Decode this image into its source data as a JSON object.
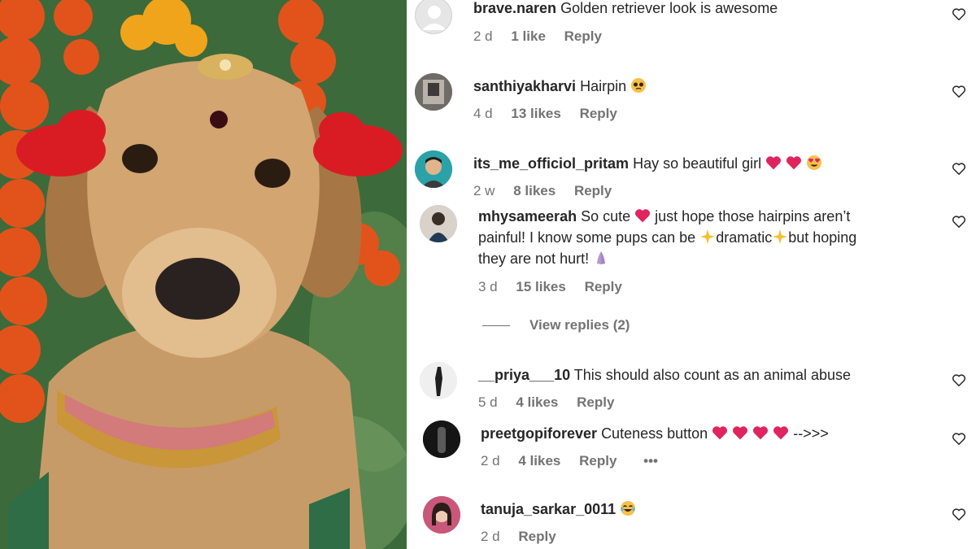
{
  "comments": [
    {
      "username": "brave.naren",
      "text": "Golden retriever look is awesome",
      "time": "2 d",
      "likes": "1 like",
      "reply": "Reply",
      "avatar": "default-avatar"
    },
    {
      "username": "santhiyakharvi",
      "text": "Hairpin",
      "time": "4 d",
      "likes": "13 likes",
      "reply": "Reply",
      "avatar": "photo-avatar"
    },
    {
      "username": "its_me_officiol_pritam",
      "text": "Hay so beautiful girl",
      "time": "2 w",
      "likes": "8 likes",
      "reply": "Reply",
      "avatar": "photo-avatar"
    },
    {
      "username": "mhysameerah",
      "text_a": "So cute",
      "text_b": "just hope those hairpins aren’t",
      "text_c": "painful! I know some pups can be",
      "text_d": "dramatic",
      "text_e": "but hoping",
      "text_f": "they are not hurt!",
      "time": "3 d",
      "likes": "15 likes",
      "reply": "Reply",
      "avatar": "photo-avatar"
    },
    {
      "username": "__priya___10",
      "text": "This should also count as an animal abuse",
      "time": "5 d",
      "likes": "4 likes",
      "reply": "Reply",
      "avatar": "photo-avatar"
    },
    {
      "username": "preetgopiforever",
      "text": "Cuteness button",
      "text_tail": "-->>>",
      "time": "2 d",
      "likes": "4 likes",
      "reply": "Reply",
      "more": "•••",
      "avatar": "photo-avatar"
    },
    {
      "username": "tanuja_sarkar_0011",
      "text": "",
      "time": "2 d",
      "likes": "",
      "reply": "Reply",
      "avatar": "photo-avatar"
    }
  ],
  "view_replies": "View replies (2)",
  "colors": {
    "text": "#262626",
    "meta": "#737373",
    "heart_emoji": "#e0245e"
  }
}
